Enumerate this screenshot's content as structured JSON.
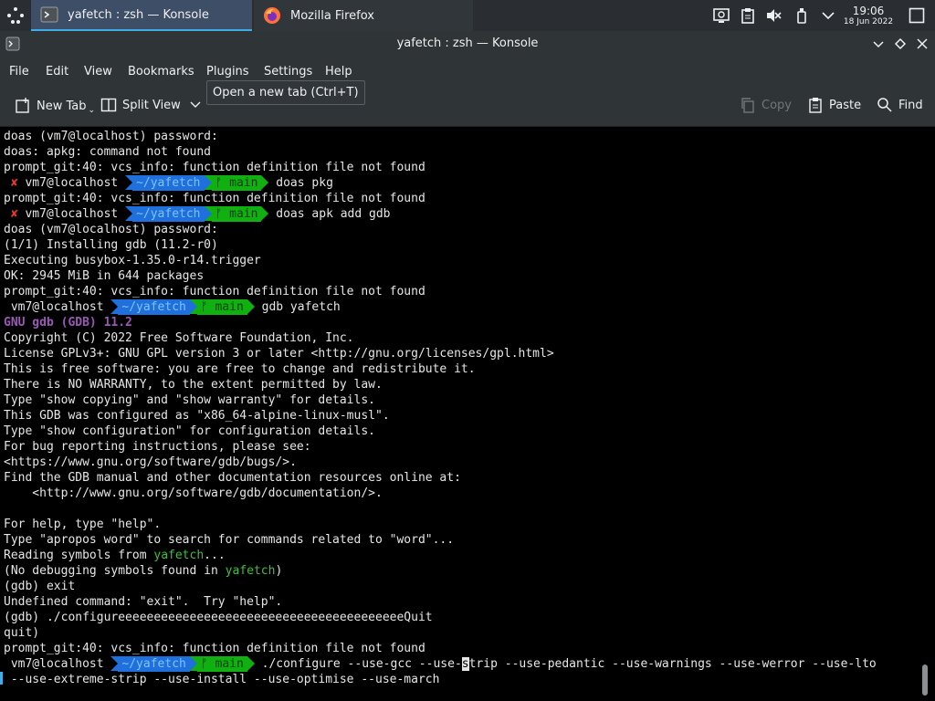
{
  "taskbar": {
    "tasks": [
      {
        "label": "yafetch : zsh — Konsole",
        "icon": "konsole-icon"
      },
      {
        "label": "Mozilla Firefox",
        "icon": "firefox-icon"
      }
    ],
    "clock": {
      "time": "19:06",
      "date": "18 Jun 2022"
    }
  },
  "window": {
    "title": "yafetch : zsh — Konsole"
  },
  "menubar": {
    "items": [
      "File",
      "Edit",
      "View",
      "Bookmarks",
      "Plugins",
      "Settings",
      "Help"
    ]
  },
  "toolbar": {
    "new_tab": "New Tab",
    "split_view": "Split View",
    "copy": "Copy",
    "paste": "Paste",
    "find": "Find",
    "tooltip": "Open a new tab (Ctrl+T)"
  },
  "terminal": {
    "lines": [
      {
        "text": "doas (vm7@localhost) password:"
      },
      {
        "text": "doas: apkg: command not found"
      },
      {
        "text": "prompt_git:40: vcs_info: function definition file not found"
      },
      {
        "prompt": true,
        "error": true,
        "user": "vm7@localhost",
        "path": "~/yafetch",
        "git": "ᚠ main",
        "cmd": "doas pkg"
      },
      {
        "text": "prompt_git:40: vcs_info: function definition file not found"
      },
      {
        "prompt": true,
        "error": true,
        "user": "vm7@localhost",
        "path": "~/yafetch",
        "git": "ᚠ main",
        "cmd": "doas apk add gdb"
      },
      {
        "text": "doas (vm7@localhost) password:"
      },
      {
        "text": "(1/1) Installing gdb (11.2-r0)"
      },
      {
        "text": "Executing busybox-1.35.0-r14.trigger"
      },
      {
        "text": "OK: 2945 MiB in 644 packages"
      },
      {
        "text": "prompt_git:40: vcs_info: function definition file not found"
      },
      {
        "prompt": true,
        "error": false,
        "user": "vm7@localhost",
        "path": "~/yafetch",
        "git": "ᚠ main",
        "cmd": "gdb yafetch"
      },
      {
        "text": "GNU gdb (GDB) 11.2",
        "style": "purple"
      },
      {
        "text": "Copyright (C) 2022 Free Software Foundation, Inc."
      },
      {
        "text": "License GPLv3+: GNU GPL version 3 or later <http://gnu.org/licenses/gpl.html>"
      },
      {
        "text": "This is free software: you are free to change and redistribute it."
      },
      {
        "text": "There is NO WARRANTY, to the extent permitted by law."
      },
      {
        "text": "Type \"show copying\" and \"show warranty\" for details."
      },
      {
        "text": "This GDB was configured as \"x86_64-alpine-linux-musl\"."
      },
      {
        "text": "Type \"show configuration\" for configuration details."
      },
      {
        "text": "For bug reporting instructions, please see:"
      },
      {
        "text": "<https://www.gnu.org/software/gdb/bugs/>."
      },
      {
        "text": "Find the GDB manual and other documentation resources online at:"
      },
      {
        "text": "    <http://www.gnu.org/software/gdb/documentation/>."
      },
      {
        "text": ""
      },
      {
        "text": "For help, type \"help\"."
      },
      {
        "text": "Type \"apropos word\" to search for commands related to \"word\"..."
      },
      {
        "pre": "Reading symbols from ",
        "hl": "yafetch",
        "post": "..."
      },
      {
        "pre": "(No debugging symbols found in ",
        "hl": "yafetch",
        "post": ")"
      },
      {
        "text": "(gdb) exit"
      },
      {
        "text": "Undefined command: \"exit\".  Try \"help\"."
      },
      {
        "text": "(gdb) ./configureeeeeeeeeeeeeeeeeeeeeeeeeeeeeeeeeeeeeeeeQuit"
      },
      {
        "text": "quit)"
      },
      {
        "text": "prompt_git:40: vcs_info: function definition file not found"
      },
      {
        "prompt": true,
        "error": false,
        "user": "vm7@localhost",
        "path": "~/yafetch",
        "git": "ᚠ main",
        "cmd_pre": "./configure --use-gcc --use-",
        "cmd_cursor": "s",
        "cmd_post": "trip --use-pedantic --use-warnings --use-werror --use-lto"
      },
      {
        "text": " --use-extreme-strip --use-install --use-optimise --use-march"
      }
    ]
  }
}
